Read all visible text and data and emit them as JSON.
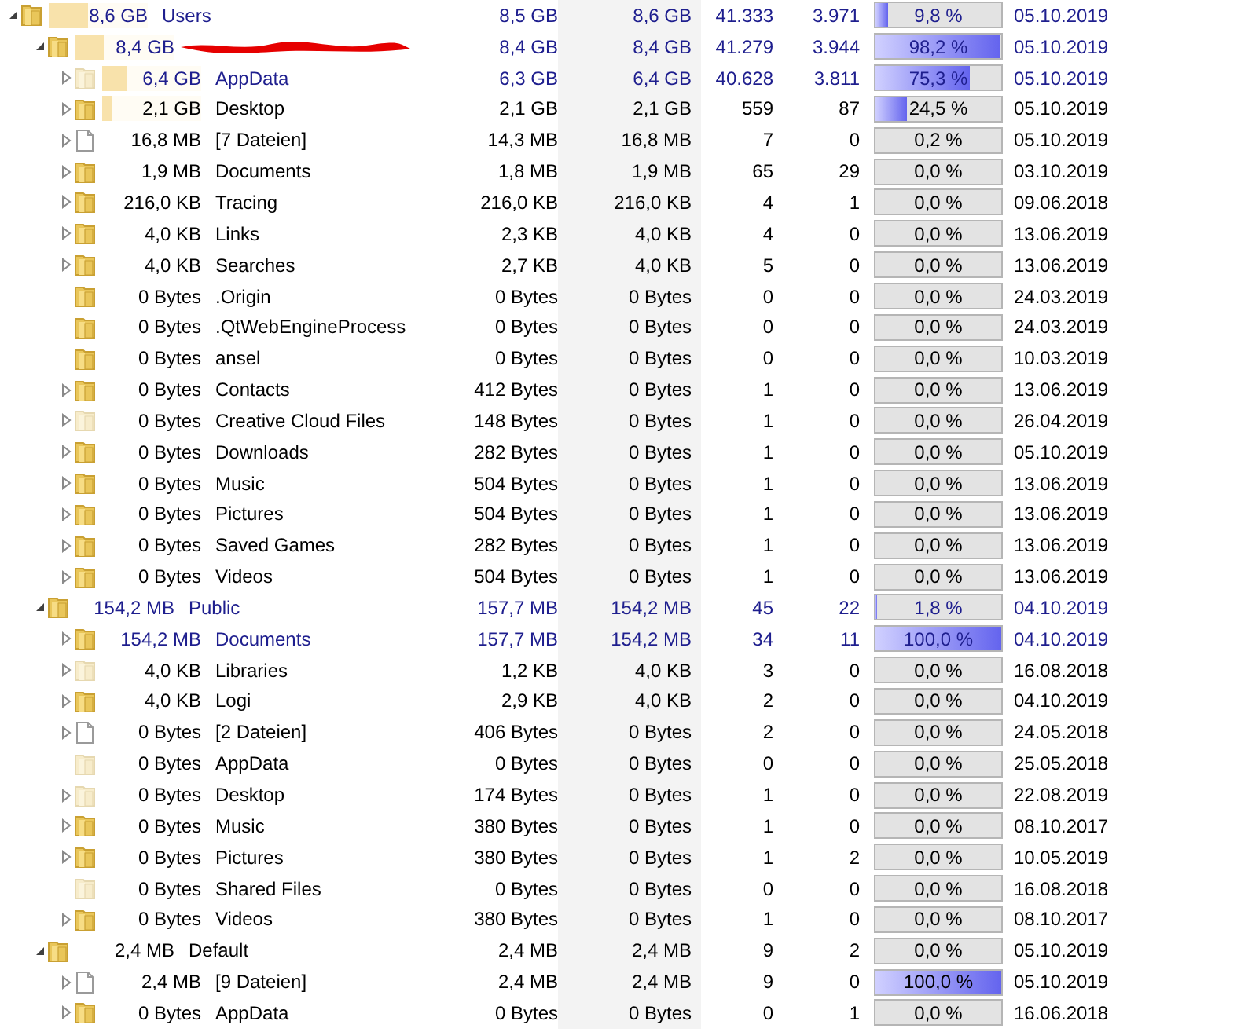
{
  "tree": [
    {
      "kind": "folder",
      "name": "Users",
      "size": "8,6 GB",
      "size_bar": {
        "level": 0.4
      },
      "highlight": true,
      "expanded": true,
      "columns": [
        "8,5 GB",
        "8,6 GB",
        "41.333",
        "3.971"
      ],
      "percent": {
        "text": "9,8 %",
        "level": 0.098
      },
      "date": "05.10.2019",
      "children": [
        {
          "kind": "folder",
          "redacted": true,
          "size": "8,4 GB",
          "size_bar": {
            "level": 0.28
          },
          "highlight": true,
          "expanded": true,
          "columns": [
            "8,4 GB",
            "8,4 GB",
            "41.279",
            "3.944"
          ],
          "percent": {
            "text": "98,2 %",
            "level": 0.982
          },
          "date": "05.10.2019",
          "children": [
            {
              "kind": "folder",
              "hidden": true,
              "name": "AppData",
              "size": "6,4 GB",
              "size_bar": {
                "level": 0.26
              },
              "highlight": true,
              "expanded": false,
              "columns": [
                "6,3 GB",
                "6,4 GB",
                "40.628",
                "3.811"
              ],
              "percent": {
                "text": "75,3 %",
                "level": 0.753
              },
              "date": "05.10.2019"
            },
            {
              "kind": "folder",
              "name": "Desktop",
              "size": "2,1 GB",
              "size_bar": {
                "level": 0.09
              },
              "expanded": false,
              "columns": [
                "2,1 GB",
                "2,1 GB",
                "559",
                "87"
              ],
              "percent": {
                "text": "24,5 %",
                "level": 0.245
              },
              "date": "05.10.2019"
            },
            {
              "kind": "file",
              "name": "[7 Dateien]",
              "size": "16,8 MB",
              "expanded": false,
              "columns": [
                "14,3 MB",
                "16,8 MB",
                "7",
                "0"
              ],
              "percent": {
                "text": "0,2 %",
                "level": 0.002
              },
              "date": "05.10.2019"
            },
            {
              "kind": "folder",
              "name": "Documents",
              "size": "1,9 MB",
              "expanded": false,
              "columns": [
                "1,8 MB",
                "1,9 MB",
                "65",
                "29"
              ],
              "percent": {
                "text": "0,0 %"
              },
              "date": "03.10.2019"
            },
            {
              "kind": "folder",
              "name": "Tracing",
              "size": "216,0 KB",
              "expanded": false,
              "columns": [
                "216,0 KB",
                "216,0 KB",
                "4",
                "1"
              ],
              "percent": {
                "text": "0,0 %"
              },
              "date": "09.06.2018"
            },
            {
              "kind": "folder",
              "name": "Links",
              "size": "4,0 KB",
              "expanded": false,
              "columns": [
                "2,3 KB",
                "4,0 KB",
                "4",
                "0"
              ],
              "percent": {
                "text": "0,0 %"
              },
              "date": "13.06.2019"
            },
            {
              "kind": "folder",
              "name": "Searches",
              "size": "4,0 KB",
              "expanded": false,
              "columns": [
                "2,7 KB",
                "4,0 KB",
                "5",
                "0"
              ],
              "percent": {
                "text": "0,0 %"
              },
              "date": "13.06.2019"
            },
            {
              "kind": "folder",
              "name": ".Origin",
              "size": "0 Bytes",
              "columns": [
                "0 Bytes",
                "0 Bytes",
                "0",
                "0"
              ],
              "percent": {
                "text": "0,0 %"
              },
              "date": "24.03.2019"
            },
            {
              "kind": "folder",
              "name": ".QtWebEngineProcess",
              "size": "0 Bytes",
              "columns": [
                "0 Bytes",
                "0 Bytes",
                "0",
                "0"
              ],
              "percent": {
                "text": "0,0 %"
              },
              "date": "24.03.2019"
            },
            {
              "kind": "folder",
              "name": "ansel",
              "size": "0 Bytes",
              "columns": [
                "0 Bytes",
                "0 Bytes",
                "0",
                "0"
              ],
              "percent": {
                "text": "0,0 %"
              },
              "date": "10.03.2019"
            },
            {
              "kind": "folder",
              "name": "Contacts",
              "size": "0 Bytes",
              "expanded": false,
              "columns": [
                "412 Bytes",
                "0 Bytes",
                "1",
                "0"
              ],
              "percent": {
                "text": "0,0 %"
              },
              "date": "13.06.2019"
            },
            {
              "kind": "folder",
              "hidden": true,
              "name": "Creative Cloud Files",
              "size": "0 Bytes",
              "expanded": false,
              "columns": [
                "148 Bytes",
                "0 Bytes",
                "1",
                "0"
              ],
              "percent": {
                "text": "0,0 %"
              },
              "date": "26.04.2019"
            },
            {
              "kind": "folder",
              "name": "Downloads",
              "size": "0 Bytes",
              "expanded": false,
              "columns": [
                "282 Bytes",
                "0 Bytes",
                "1",
                "0"
              ],
              "percent": {
                "text": "0,0 %"
              },
              "date": "05.10.2019"
            },
            {
              "kind": "folder",
              "name": "Music",
              "size": "0 Bytes",
              "expanded": false,
              "columns": [
                "504 Bytes",
                "0 Bytes",
                "1",
                "0"
              ],
              "percent": {
                "text": "0,0 %"
              },
              "date": "13.06.2019"
            },
            {
              "kind": "folder",
              "name": "Pictures",
              "size": "0 Bytes",
              "expanded": false,
              "columns": [
                "504 Bytes",
                "0 Bytes",
                "1",
                "0"
              ],
              "percent": {
                "text": "0,0 %"
              },
              "date": "13.06.2019"
            },
            {
              "kind": "folder",
              "name": "Saved Games",
              "size": "0 Bytes",
              "expanded": false,
              "columns": [
                "282 Bytes",
                "0 Bytes",
                "1",
                "0"
              ],
              "percent": {
                "text": "0,0 %"
              },
              "date": "13.06.2019"
            },
            {
              "kind": "folder",
              "name": "Videos",
              "size": "0 Bytes",
              "expanded": false,
              "columns": [
                "504 Bytes",
                "0 Bytes",
                "1",
                "0"
              ],
              "percent": {
                "text": "0,0 %"
              },
              "date": "13.06.2019"
            }
          ]
        },
        {
          "kind": "folder",
          "name": "Public",
          "size": "154,2 MB",
          "highlight": true,
          "expanded": true,
          "columns": [
            "157,7 MB",
            "154,2 MB",
            "45",
            "22"
          ],
          "percent": {
            "text": "1,8 %",
            "level": 0.018
          },
          "date": "04.10.2019",
          "children": [
            {
              "kind": "folder",
              "name": "Documents",
              "size": "154,2 MB",
              "highlight": true,
              "expanded": false,
              "columns": [
                "157,7 MB",
                "154,2 MB",
                "34",
                "11"
              ],
              "percent": {
                "text": "100,0 %",
                "level": 1
              },
              "date": "04.10.2019"
            },
            {
              "kind": "folder",
              "hidden": true,
              "name": "Libraries",
              "size": "4,0 KB",
              "expanded": false,
              "columns": [
                "1,2 KB",
                "4,0 KB",
                "3",
                "0"
              ],
              "percent": {
                "text": "0,0 %"
              },
              "date": "16.08.2018"
            },
            {
              "kind": "folder",
              "name": "Logi",
              "size": "4,0 KB",
              "expanded": false,
              "columns": [
                "2,9 KB",
                "4,0 KB",
                "2",
                "0"
              ],
              "percent": {
                "text": "0,0 %"
              },
              "date": "04.10.2019"
            },
            {
              "kind": "file",
              "name": "[2 Dateien]",
              "size": "0 Bytes",
              "expanded": false,
              "columns": [
                "406 Bytes",
                "0 Bytes",
                "2",
                "0"
              ],
              "percent": {
                "text": "0,0 %"
              },
              "date": "24.05.2018"
            },
            {
              "kind": "folder",
              "hidden": true,
              "name": "AppData",
              "size": "0 Bytes",
              "columns": [
                "0 Bytes",
                "0 Bytes",
                "0",
                "0"
              ],
              "percent": {
                "text": "0,0 %"
              },
              "date": "25.05.2018"
            },
            {
              "kind": "folder",
              "hidden": true,
              "name": "Desktop",
              "size": "0 Bytes",
              "expanded": false,
              "columns": [
                "174 Bytes",
                "0 Bytes",
                "1",
                "0"
              ],
              "percent": {
                "text": "0,0 %"
              },
              "date": "22.08.2019"
            },
            {
              "kind": "folder",
              "name": "Music",
              "size": "0 Bytes",
              "expanded": false,
              "columns": [
                "380 Bytes",
                "0 Bytes",
                "1",
                "0"
              ],
              "percent": {
                "text": "0,0 %"
              },
              "date": "08.10.2017"
            },
            {
              "kind": "folder",
              "name": "Pictures",
              "size": "0 Bytes",
              "expanded": false,
              "columns": [
                "380 Bytes",
                "0 Bytes",
                "1",
                "2"
              ],
              "percent": {
                "text": "0,0 %"
              },
              "date": "10.05.2019"
            },
            {
              "kind": "folder",
              "hidden": true,
              "name": "Shared Files",
              "size": "0 Bytes",
              "columns": [
                "0 Bytes",
                "0 Bytes",
                "0",
                "0"
              ],
              "percent": {
                "text": "0,0 %"
              },
              "date": "16.08.2018"
            },
            {
              "kind": "folder",
              "name": "Videos",
              "size": "0 Bytes",
              "expanded": false,
              "columns": [
                "380 Bytes",
                "0 Bytes",
                "1",
                "0"
              ],
              "percent": {
                "text": "0,0 %"
              },
              "date": "08.10.2017"
            }
          ]
        },
        {
          "kind": "folder",
          "name": "Default",
          "size": "2,4 MB",
          "expanded": true,
          "columns": [
            "2,4 MB",
            "2,4 MB",
            "9",
            "2"
          ],
          "percent": {
            "text": "0,0 %"
          },
          "date": "05.10.2019",
          "children": [
            {
              "kind": "file",
              "name": "[9 Dateien]",
              "size": "2,4 MB",
              "expanded": false,
              "columns": [
                "2,4 MB",
                "2,4 MB",
                "9",
                "0"
              ],
              "percent": {
                "text": "100,0 %",
                "level": 1
              },
              "date": "05.10.2019"
            },
            {
              "kind": "folder",
              "name": "AppData",
              "size": "0 Bytes",
              "expanded": false,
              "columns": [
                "0 Bytes",
                "0 Bytes",
                "0",
                "1"
              ],
              "percent": {
                "text": "0,0 %"
              },
              "date": "16.06.2018"
            }
          ]
        }
      ]
    }
  ]
}
